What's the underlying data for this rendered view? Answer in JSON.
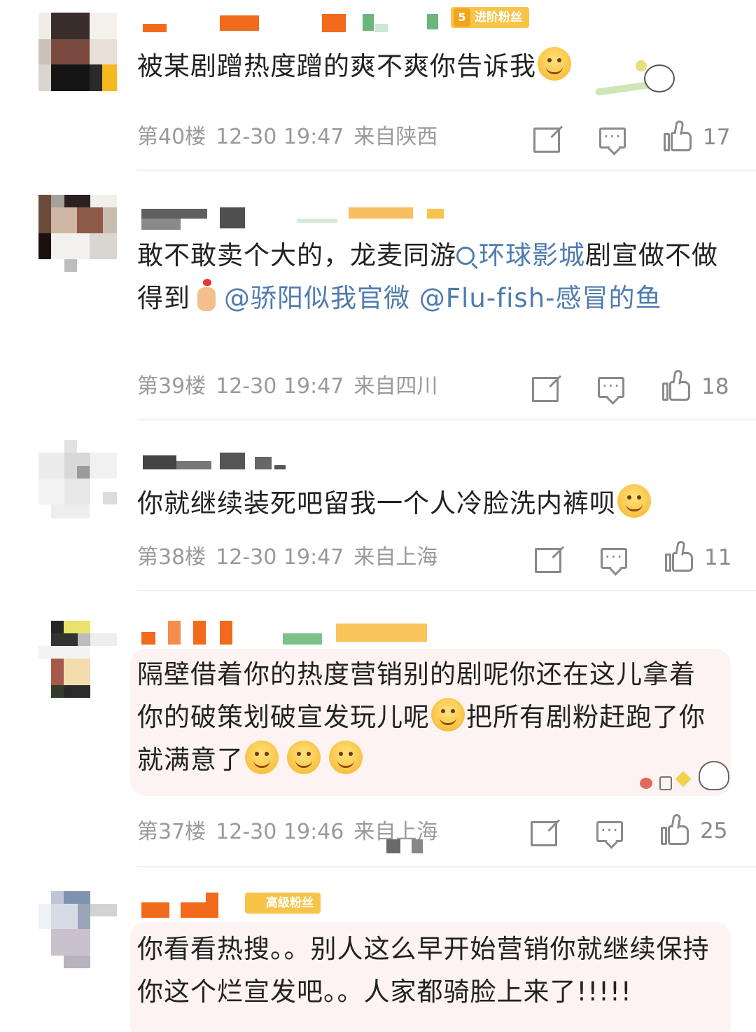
{
  "comments": [
    {
      "id": "c40",
      "badge": {
        "level": "5",
        "label": "进阶粉丝"
      },
      "text": "被某剧蹭热度蹭的爽不爽你告诉我",
      "meta": {
        "floor": "第40楼",
        "time": "12-30 19:47",
        "location": "来自陕西"
      },
      "likes": "17"
    },
    {
      "id": "c39",
      "text_parts": [
        "敢不敢卖个大的，龙麦同游",
        "环球影城",
        "剧宣做不做得到",
        "@骄阳似我官微 @Flu-fish-感冒的鱼"
      ],
      "meta": {
        "floor": "第39楼",
        "time": "12-30 19:47",
        "location": "来自四川"
      },
      "likes": "18"
    },
    {
      "id": "c38",
      "text": "你就继续装死吧留我一个人冷脸洗内裤呗",
      "meta": {
        "floor": "第38楼",
        "time": "12-30 19:47",
        "location": "来自上海"
      },
      "likes": "11"
    },
    {
      "id": "c37",
      "text_parts": [
        "隔壁借着你的热度营销别的剧呢你还在这儿拿着你的破策划破宣发玩儿呢",
        "把所有剧粉赶跑了你就满意了"
      ],
      "meta": {
        "floor": "第37楼",
        "time": "12-30 19:46",
        "location": "来自上海"
      },
      "likes": "25"
    },
    {
      "id": "c36",
      "badge": {
        "label": "高级粉丝"
      },
      "text": "你看看热搜。。别人这么早开始营销你就继续保持你这个烂宣发吧。。人家都骑脸上来了!!!!!"
    }
  ],
  "colors": {
    "link": "#4f7cae",
    "meta": "#9a9a9a",
    "badge": "#f7c44a",
    "bubble": "#fdf3f3"
  },
  "icons": [
    "share-icon",
    "comment-icon",
    "like-icon",
    "topic-search-icon"
  ]
}
